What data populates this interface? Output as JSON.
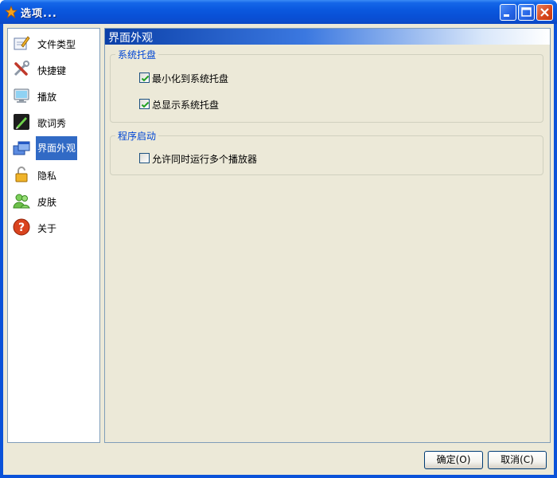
{
  "window": {
    "title": "选项..."
  },
  "sidebar": {
    "items": [
      {
        "label": "文件类型",
        "icon": "file-type-icon"
      },
      {
        "label": "快捷键",
        "icon": "hotkey-tools-icon"
      },
      {
        "label": "播放",
        "icon": "monitor-icon"
      },
      {
        "label": "歌词秀",
        "icon": "lyrics-pen-icon"
      },
      {
        "label": "界面外观",
        "icon": "windows-appearance-icon",
        "active": true
      },
      {
        "label": "隐私",
        "icon": "lock-icon"
      },
      {
        "label": "皮肤",
        "icon": "users-skin-icon"
      },
      {
        "label": "关于",
        "icon": "help-icon"
      }
    ]
  },
  "panel": {
    "title": "界面外观",
    "groups": [
      {
        "title": "系统托盘",
        "options": [
          {
            "label": "最小化到系统托盘",
            "checked": true
          },
          {
            "label": "总显示系统托盘",
            "checked": true
          }
        ]
      },
      {
        "title": "程序启动",
        "options": [
          {
            "label": "允许同时运行多个播放器",
            "checked": false
          }
        ]
      }
    ]
  },
  "buttons": {
    "ok": "确定(O)",
    "cancel": "取消(C)"
  },
  "colors": {
    "titlebar": "#0a52d9",
    "selection": "#316ac5",
    "group_title": "#0046d5"
  }
}
